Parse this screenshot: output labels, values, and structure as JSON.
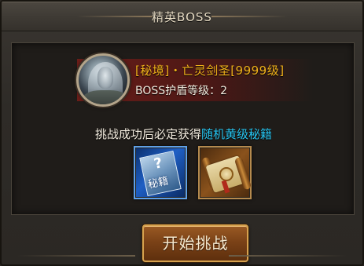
{
  "window": {
    "title": "精英BOSS"
  },
  "boss": {
    "name": "[秘境]・亡灵剑圣[9999级]",
    "shield_label": "BOSS护盾等级：",
    "shield_level": "2"
  },
  "reward": {
    "prefix": "挑战成功后必定获得",
    "highlight": "随机黄级秘籍",
    "items": [
      {
        "icon": "secret-book-icon",
        "glyph": "秘籍",
        "mark": "?"
      },
      {
        "icon": "scroll-icon"
      }
    ]
  },
  "actions": {
    "start_label": "开始挑战"
  },
  "colors": {
    "boss_name": "#f0b21a",
    "highlight": "#26c4f0",
    "button_border": "#d6a24e"
  }
}
